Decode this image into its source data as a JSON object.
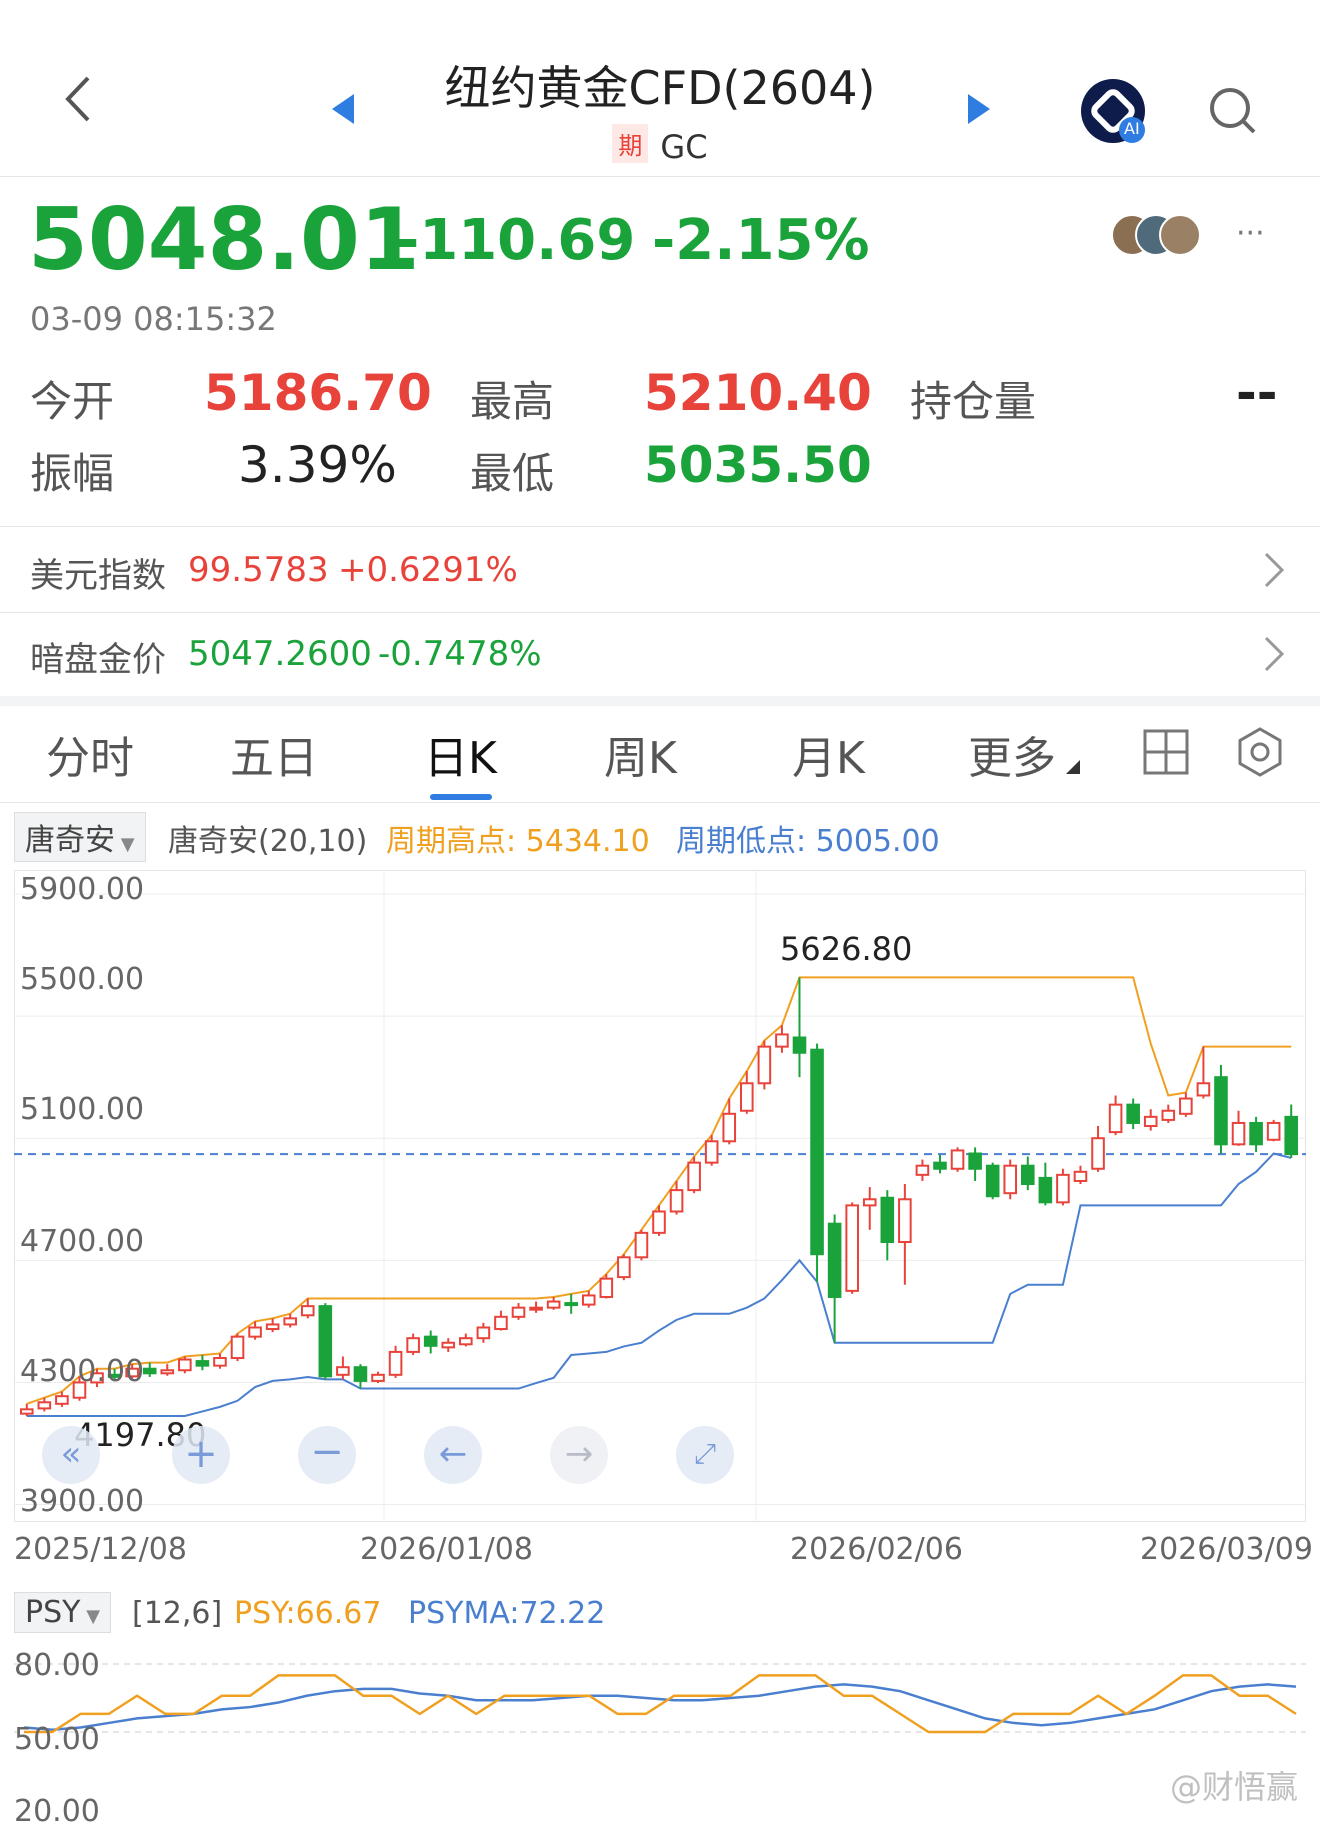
{
  "header": {
    "title": "纽约黄金CFD(2604)",
    "badge": "期",
    "code": "GC",
    "ai_label": "AI"
  },
  "quote": {
    "price": "5048.01",
    "change": "-110.69",
    "change_pct": "-2.15%",
    "time": "03-09 08:15:32",
    "open_label": "今开",
    "open": "5186.70",
    "high_label": "最高",
    "high": "5210.40",
    "oi_label": "持仓量",
    "oi": "--",
    "amp_label": "振幅",
    "amp": "3.39%",
    "low_label": "最低",
    "low": "5035.50"
  },
  "links": [
    {
      "label": "美元指数",
      "value": "99.5783",
      "change": "+0.6291%"
    },
    {
      "label": "暗盘金价",
      "value": "5047.2600",
      "change": "-0.7478%"
    }
  ],
  "tabs": [
    "分时",
    "五日",
    "日K",
    "周K",
    "月K",
    "更多"
  ],
  "indicator": {
    "selector": "唐奇安",
    "name": "唐奇安(20,10)",
    "high_label": "周期高点: 5434.10",
    "low_label": "周期低点: 5005.00"
  },
  "colors": {
    "up": "#e8433a",
    "down": "#1aa33a",
    "orange": "#f0a020",
    "blue": "#4a7fd0"
  },
  "chart_data": {
    "type": "candlestick",
    "y_ticks": [
      "5900.00",
      "5500.00",
      "5100.00",
      "4700.00",
      "4300.00",
      "3900.00"
    ],
    "ylim": [
      3900,
      5900
    ],
    "x_ticks": [
      "2025/12/08",
      "2026/01/08",
      "2026/02/06",
      "2026/03/09"
    ],
    "current_price": 5048.01,
    "annotations": {
      "max": "5626.80",
      "min": "4197.80"
    },
    "candles": [
      [
        4197.8,
        4212,
        4190,
        4230
      ],
      [
        4215,
        4235,
        4205,
        4250
      ],
      [
        4230,
        4255,
        4220,
        4270
      ],
      [
        4250,
        4300,
        4240,
        4320
      ],
      [
        4300,
        4330,
        4285,
        4345
      ],
      [
        4325,
        4320,
        4305,
        4345
      ],
      [
        4320,
        4345,
        4310,
        4360
      ],
      [
        4345,
        4330,
        4318,
        4365
      ],
      [
        4330,
        4340,
        4322,
        4360
      ],
      [
        4340,
        4375,
        4330,
        4385
      ],
      [
        4370,
        4355,
        4340,
        4390
      ],
      [
        4355,
        4380,
        4345,
        4395
      ],
      [
        4380,
        4450,
        4370,
        4460
      ],
      [
        4450,
        4480,
        4440,
        4500
      ],
      [
        4475,
        4490,
        4465,
        4510
      ],
      [
        4490,
        4510,
        4480,
        4525
      ],
      [
        4520,
        4550,
        4510,
        4575
      ],
      [
        4550,
        4320,
        4310,
        4560
      ],
      [
        4325,
        4350,
        4310,
        4385
      ],
      [
        4350,
        4305,
        4280,
        4360
      ],
      [
        4305,
        4325,
        4298,
        4335
      ],
      [
        4325,
        4400,
        4315,
        4420
      ],
      [
        4400,
        4445,
        4390,
        4460
      ],
      [
        4450,
        4420,
        4395,
        4470
      ],
      [
        4415,
        4430,
        4400,
        4445
      ],
      [
        4425,
        4445,
        4418,
        4460
      ],
      [
        4445,
        4480,
        4430,
        4495
      ],
      [
        4475,
        4515,
        4470,
        4535
      ],
      [
        4515,
        4545,
        4505,
        4560
      ],
      [
        4540,
        4545,
        4528,
        4565
      ],
      [
        4545,
        4565,
        4538,
        4580
      ],
      [
        4560,
        4555,
        4525,
        4590
      ],
      [
        4555,
        4585,
        4545,
        4600
      ],
      [
        4580,
        4640,
        4575,
        4655
      ],
      [
        4645,
        4710,
        4635,
        4720
      ],
      [
        4710,
        4790,
        4700,
        4800
      ],
      [
        4790,
        4860,
        4780,
        4880
      ],
      [
        4860,
        4930,
        4850,
        4960
      ],
      [
        4930,
        5020,
        4920,
        5040
      ],
      [
        5020,
        5090,
        5010,
        5110
      ],
      [
        5090,
        5180,
        5080,
        5230
      ],
      [
        5190,
        5280,
        5180,
        5320
      ],
      [
        5280,
        5400,
        5260,
        5420
      ],
      [
        5400,
        5440,
        5380,
        5470
      ],
      [
        5430,
        5380,
        5300,
        5626.8
      ],
      [
        5390,
        4720,
        4630,
        5410
      ],
      [
        4820,
        4580,
        4430,
        4850
      ],
      [
        4600,
        4880,
        4590,
        4890
      ],
      [
        4880,
        4900,
        4800,
        4940
      ],
      [
        4905,
        4760,
        4700,
        4930
      ],
      [
        4760,
        4900,
        4620,
        4950
      ],
      [
        4980,
        5010,
        4960,
        5030
      ],
      [
        5020,
        5000,
        4985,
        5045
      ],
      [
        5000,
        5060,
        4990,
        5070
      ],
      [
        5050,
        5000,
        4960,
        5070
      ],
      [
        5010,
        4910,
        4900,
        5020
      ],
      [
        4920,
        5010,
        4900,
        5030
      ],
      [
        5010,
        4950,
        4930,
        5040
      ],
      [
        4970,
        4890,
        4880,
        5020
      ],
      [
        4890,
        4980,
        4880,
        5000
      ],
      [
        4960,
        4990,
        4950,
        5010
      ],
      [
        5000,
        5100,
        4990,
        5140
      ],
      [
        5120,
        5210,
        5110,
        5240
      ],
      [
        5210,
        5150,
        5130,
        5230
      ],
      [
        5140,
        5170,
        5125,
        5195
      ],
      [
        5160,
        5190,
        5150,
        5210
      ],
      [
        5180,
        5230,
        5170,
        5250
      ],
      [
        5240,
        5280,
        5230,
        5400
      ],
      [
        5300,
        5080,
        5050,
        5340
      ],
      [
        5080,
        5150,
        5075,
        5190
      ],
      [
        5150,
        5080,
        5055,
        5170
      ],
      [
        5095,
        5150,
        5090,
        5160
      ],
      [
        5170,
        5048.01,
        5035.5,
        5210.4
      ]
    ],
    "psy": {
      "selector": "PSY",
      "params": "[12,6]",
      "psy_label": "PSY:66.67",
      "psyma_label": "PSYMA:72.22",
      "y_ticks": [
        "80.00",
        "50.00",
        "20.00"
      ]
    }
  },
  "watermark": "@财悟赢"
}
